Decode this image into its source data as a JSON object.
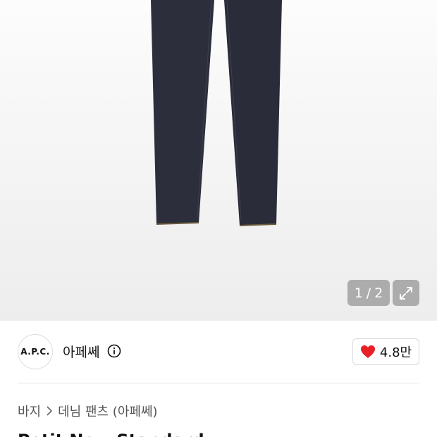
{
  "gallery": {
    "current": "1",
    "separator": "/",
    "total": "2"
  },
  "brand": {
    "logo_text": "A.P.C.",
    "name": "아페쎄"
  },
  "like": {
    "count": "4.8만",
    "heart_color": "#e8202a"
  },
  "breadcrumb": {
    "category": "바지",
    "subcategory": "데님 팬츠 (아페쎄)"
  },
  "product": {
    "title_partial": "Petit New Standard"
  }
}
